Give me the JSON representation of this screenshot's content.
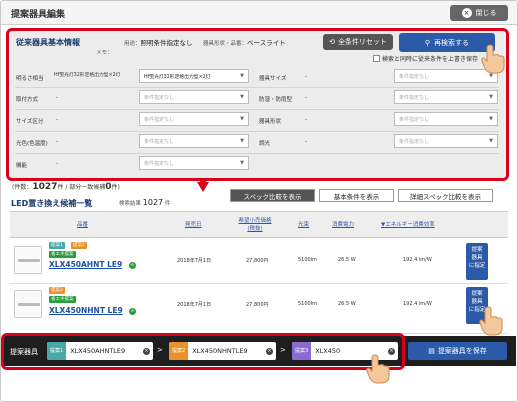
{
  "dialog": {
    "title": "提案器具編集",
    "close_label": "閉じる"
  },
  "current": {
    "title": "従来器具基本情報",
    "usage_label": "用途：",
    "usage_value": "照明条件指定なし",
    "model_label": "器具形状・品番：",
    "model_value": "ベースライト",
    "memo_label": "メモ：",
    "reset_label": "全条件リセット",
    "search_label": "再検索する",
    "overwrite_label": "検索と同時に従来条件を上書き保存",
    "rows": [
      {
        "label": "明るさ相当",
        "value": "Hf蛍光灯32形定格出力型×2灯",
        "select": "Hf蛍光灯32形定格出力型×2灯",
        "label2": "器具サイズ",
        "value2": "-",
        "select2": "条件指定なし"
      },
      {
        "label": "取付方式",
        "value": "-",
        "select": "条件指定なし",
        "label2": "防湿・防雨型",
        "value2": "-",
        "select2": "条件指定なし"
      },
      {
        "label": "サイズ区分",
        "value": "-",
        "select": "条件指定なし",
        "label2": "器具形状",
        "value2": "-",
        "select2": "条件指定なし"
      },
      {
        "label": "光色(色温度)",
        "value": "-",
        "select": "条件指定なし",
        "label2": "調光",
        "value2": "-",
        "select2": "条件指定なし"
      },
      {
        "label": "機能",
        "value": "-",
        "select": "条件指定なし"
      }
    ]
  },
  "hits": {
    "prefix": "(件数：",
    "count1": "1027",
    "mid": "件 / 部分一致候補",
    "count2": "0",
    "suffix": "件)"
  },
  "tabs": [
    "スペック比較を表示",
    "基本条件を表示",
    "詳細スペック比較を表示"
  ],
  "list": {
    "title": "LED置き換え候補一覧",
    "result_label": "検索結果",
    "result_count": "1027",
    "result_unit": "件",
    "headers": [
      "品番",
      "発売日",
      "希望小売価格(税抜)",
      "光束",
      "消費電力",
      "▼エネルギー消費効率"
    ],
    "rows": [
      {
        "badges": [
          "提案1",
          "提案2",
          "省エネ提案"
        ],
        "name": "XLX450AHNT LE9",
        "date": "2018年7月1日",
        "price": "27,800円",
        "lumen": "5100lm",
        "watt": "26.5 W",
        "eff": "192.4 lm/W",
        "propose": [
          "提案",
          "器具",
          "に指定"
        ]
      },
      {
        "badges": [
          "提案2",
          "省エネ提案"
        ],
        "name": "XLX450NHNT LE9",
        "date": "2018年7月1日",
        "price": "27,800円",
        "lumen": "5100lm",
        "watt": "26.5 W",
        "eff": "192.4 lm/W",
        "propose": [
          "提案",
          "器具",
          "に指定"
        ]
      }
    ]
  },
  "bottom": {
    "label": "提案器具",
    "slots": [
      {
        "tag": "提案1",
        "text": "XLX450AHNTLE9",
        "color": "#4aa8a8"
      },
      {
        "tag": "提案2",
        "text": "XLX450NHNTLE9",
        "color": "#e8912d"
      },
      {
        "tag": "提案3",
        "text": "XLX450",
        "color": "#8a6bd1"
      }
    ],
    "save_label": "提案器具を保存"
  },
  "colors": {
    "accent": "#2b5aa9",
    "highlight": "#d9001b"
  }
}
